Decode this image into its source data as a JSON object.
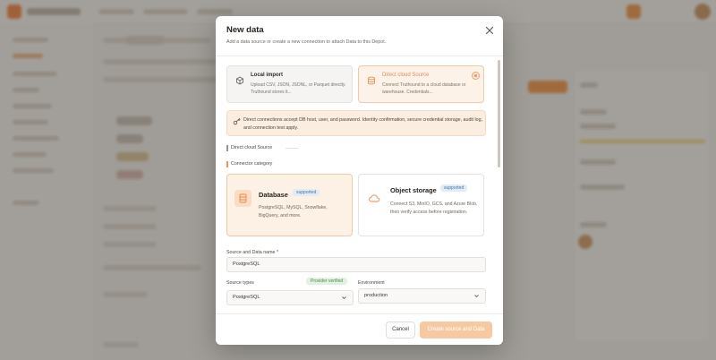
{
  "modal": {
    "title": "New data",
    "subtitle": "Add a data source or create a new connection to attach Data to this Depot."
  },
  "source_options": [
    {
      "title": "Local import",
      "description": "Upload CSV, JSON, JSONL, or Parquet directly. Truthound stores it..."
    },
    {
      "title": "Direct cloud Source",
      "description": "Connect Truthound to a cloud database or warehouse. Credentials..."
    }
  ],
  "notice": {
    "text": "Direct connections accept DB host, user, and password. Identity confirmation, secure credential storage, audit log, and connection test apply."
  },
  "sections": {
    "direct_cloud": "Direct cloud Source",
    "connector_category": "Connector category"
  },
  "categories": [
    {
      "title": "Database",
      "badge": "supported",
      "description": "PostgreSQL, MySQL, Snowflake, BigQuery, and more."
    },
    {
      "title": "Object storage",
      "badge": "supported",
      "description": "Connect S3, MinIO, GCS, and Azure Blob, then verify access before registration."
    }
  ],
  "form": {
    "name_label": "Source and Data name *",
    "name_value": "PostgreSQL",
    "source_type_label": "Source types",
    "source_type_badge": "Provider verified",
    "source_type_value": "PostgreSQL",
    "environment_label": "Environment",
    "environment_value": "production"
  },
  "footer": {
    "cancel_label": "Cancel",
    "create_label": "Create source and Data"
  },
  "colors": {
    "accent": "#ef9055",
    "accent_soft": "#fdf0e5",
    "badge_blue": "#4b74a0",
    "verified_green": "#4a8c4c"
  },
  "icons": {
    "close": "close-icon",
    "local_import": "upload-cube-icon",
    "direct_cloud": "database-icon",
    "notice": "key-icon",
    "database": "database-icon",
    "object_storage": "cloud-icon",
    "select": "chevron-down-icon"
  }
}
